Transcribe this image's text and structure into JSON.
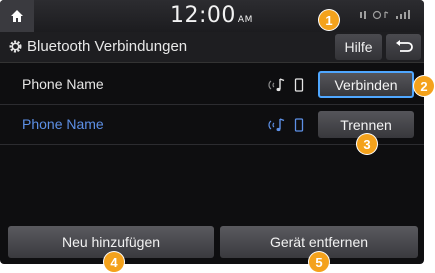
{
  "status_bar": {
    "time": "12:00",
    "ampm": "AM"
  },
  "header": {
    "title": "Bluetooth Verbindungen",
    "help_label": "Hilfe",
    "back_icon": "return-arrow"
  },
  "devices": [
    {
      "name": "Phone Name",
      "action_label": "Verbinden"
    },
    {
      "name": "Phone Name",
      "action_label": "Trennen"
    }
  ],
  "footer": {
    "add_label": "Neu hinzufügen",
    "remove_label": "Gerät entfernen"
  },
  "callouts": [
    "1",
    "2",
    "3",
    "4",
    "5"
  ],
  "colors": {
    "accent_blue": "#4fa7ff",
    "connected_name": "#5d90e6",
    "callout": "#f4a21c"
  }
}
